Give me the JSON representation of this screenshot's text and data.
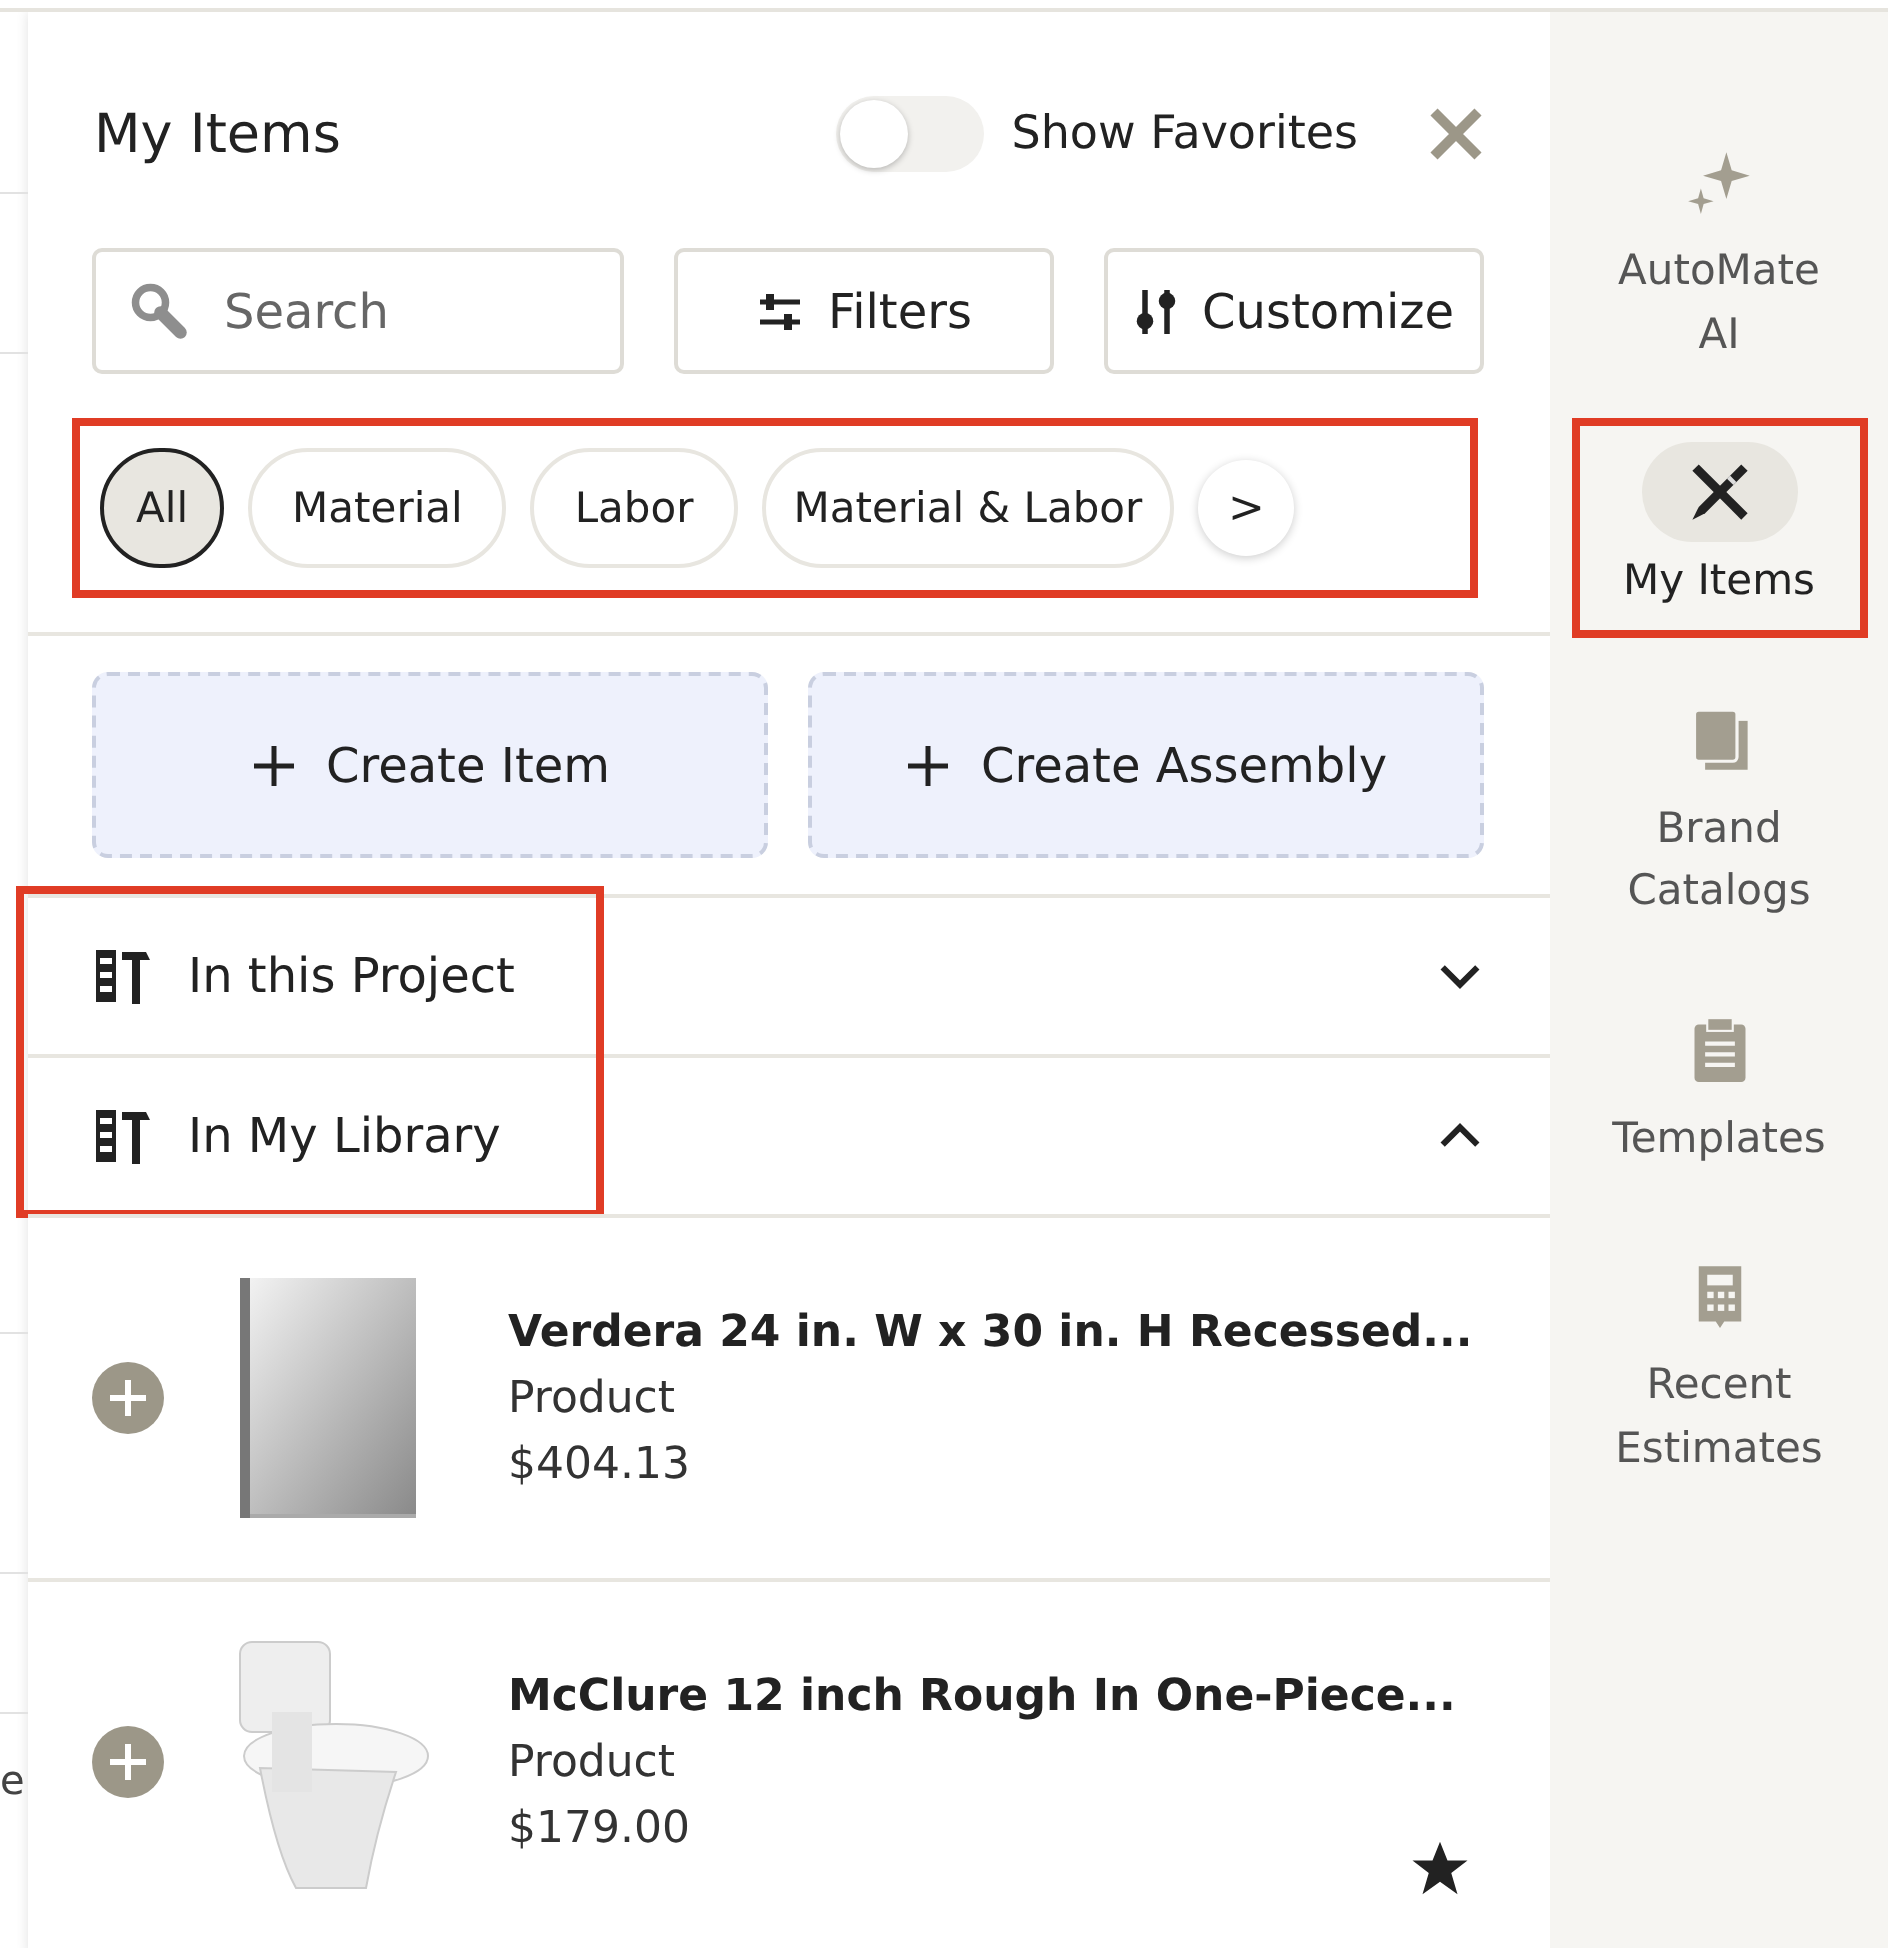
{
  "background_page": {
    "fragment": "e"
  },
  "panel": {
    "title": "My Items",
    "favorites_toggle": {
      "label": "Show Favorites",
      "on": false
    }
  },
  "search": {
    "placeholder": "Search"
  },
  "toolbar_buttons": [
    {
      "label": "Filters",
      "kind": "filters"
    },
    {
      "label": "Customize",
      "kind": "customize"
    }
  ],
  "chip_bar": {
    "highlighted": true,
    "chips": [
      {
        "label": "All",
        "selected": true
      },
      {
        "label": "Material",
        "selected": false
      },
      {
        "label": "Labor",
        "selected": false
      },
      {
        "label": "Material & Labor",
        "selected": false
      }
    ],
    "next": ">"
  },
  "create_buttons": [
    "Create Item",
    "Create Assembly"
  ],
  "sections_highlighted": true,
  "sections": [
    {
      "title": "In this Project",
      "expanded": false
    },
    {
      "title": "In My Library",
      "expanded": true
    }
  ],
  "items": [
    {
      "name": "Verdera 24 in. W x 30 in. H Recessed...",
      "type": "Product",
      "price": "$404.13",
      "favorite": false,
      "kind": "cabinet"
    },
    {
      "name": "McClure 12 inch Rough In One-Piece...",
      "type": "Product",
      "price": "$179.00",
      "favorite": true,
      "kind": "toilet"
    }
  ],
  "rail": [
    {
      "label": "AutoMate AI",
      "selected": false,
      "highlighted": false
    },
    {
      "label": "My Items",
      "selected": true,
      "highlighted": true
    },
    {
      "label": "Brand Catalogs",
      "selected": false,
      "highlighted": false
    },
    {
      "label": "Templates",
      "selected": false,
      "highlighted": false
    },
    {
      "label": "Recent Estimates",
      "selected": false,
      "highlighted": false
    }
  ]
}
